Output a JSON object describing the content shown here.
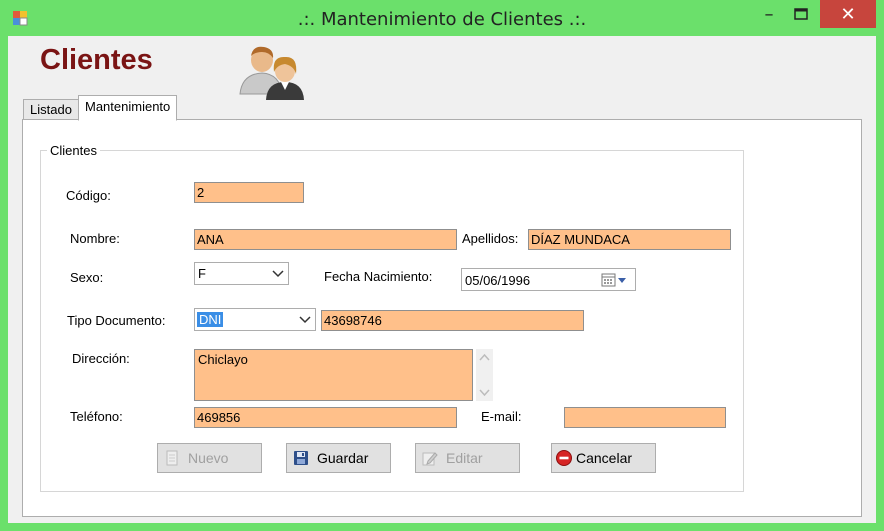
{
  "window": {
    "title": ".:. Mantenimiento de Clientes .:.",
    "controls": {
      "minimize": "–",
      "maximize": "□",
      "close": "✕"
    }
  },
  "header": {
    "title": "Clientes"
  },
  "tabs": [
    {
      "label": "Listado",
      "active": false
    },
    {
      "label": "Mantenimiento",
      "active": true
    }
  ],
  "group": {
    "label": "Clientes"
  },
  "form": {
    "codigo": {
      "label": "Código:",
      "value": "2"
    },
    "nombre": {
      "label": "Nombre:",
      "value": "ANA"
    },
    "apellidos": {
      "label": "Apellidos:",
      "value": "DÍAZ MUNDACA"
    },
    "sexo": {
      "label": "Sexo:",
      "value": "F"
    },
    "fecha_nacimiento": {
      "label": "Fecha Nacimiento:",
      "value": "05/06/1996"
    },
    "tipo_documento": {
      "label": "Tipo Documento:",
      "value": "DNI"
    },
    "numero_documento": {
      "value": "43698746"
    },
    "direccion": {
      "label": "Dirección:",
      "value": "Chiclayo"
    },
    "telefono": {
      "label": "Teléfono:",
      "value": "469856"
    },
    "email": {
      "label": "E-mail:",
      "value": ""
    }
  },
  "buttons": {
    "nuevo": {
      "label": "Nuevo",
      "enabled": false
    },
    "guardar": {
      "label": "Guardar",
      "enabled": true
    },
    "editar": {
      "label": "Editar",
      "enabled": false
    },
    "cancelar": {
      "label": "Cancelar",
      "enabled": true
    }
  },
  "colors": {
    "window_frame": "#6be06b",
    "field_fill": "#ffc08a",
    "title_text": "#7a1414",
    "close_button": "#c7453d",
    "selection": "#3a8ee6"
  }
}
